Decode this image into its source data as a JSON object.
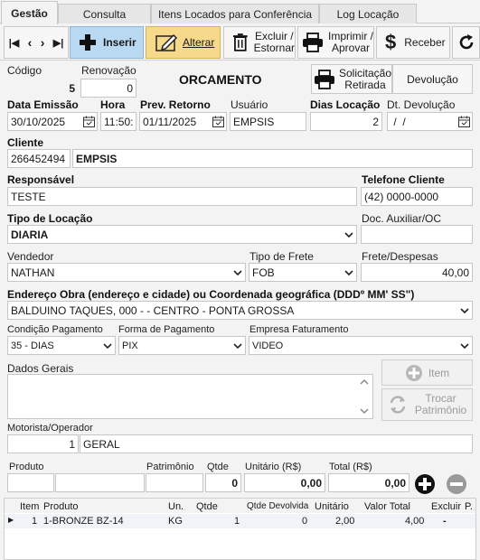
{
  "tabs": [
    "Gestão",
    "Consulta",
    "Itens Locados para Conferência",
    "Log Locação"
  ],
  "toolbar": {
    "inserir": "Inserir",
    "alterar": "Alterar",
    "excluir_1": "Excluir /",
    "excluir_2": "Estornar",
    "imprimir_1": "Imprimir /",
    "imprimir_2": "Aprovar",
    "receber": "Receber"
  },
  "header": {
    "codigo_label": "Código",
    "codigo": "5",
    "renovacao_label": "Renovação",
    "renovacao": "0",
    "title": "ORCAMENTO",
    "solicitacao_1": "Solicitação",
    "solicitacao_2": "Retirada",
    "devolucao": "Devolução"
  },
  "dates": {
    "emissao_label": "Data Emissão",
    "emissao": "30/10/2025",
    "hora_label": "Hora",
    "hora": "11:50:",
    "prev_label": "Prev. Retorno",
    "prev": "01/11/2025",
    "usuario_label": "Usuário",
    "usuario": "EMPSIS",
    "dias_label": "Dias Locação",
    "dias": "2",
    "dt_dev_label": "Dt. Devolução",
    "dt_dev": " /  /"
  },
  "cliente": {
    "label": "Cliente",
    "codigo": "266452494",
    "nome": "EMPSIS"
  },
  "responsavel": {
    "label": "Responsável",
    "value": "TESTE"
  },
  "telefone": {
    "label": "Telefone Cliente",
    "value": "(42) 0000-0000"
  },
  "tipo_locacao": {
    "label": "Tipo de Locação",
    "value": "DIARIA"
  },
  "doc_aux": {
    "label": "Doc. Auxiliar/OC",
    "value": ""
  },
  "vendedor": {
    "label": "Vendedor",
    "value": "NATHAN"
  },
  "tipo_frete": {
    "label": "Tipo de Frete",
    "value": "FOB"
  },
  "frete": {
    "label": "Frete/Despesas",
    "value": "40,00"
  },
  "endereco": {
    "label": "Endereço Obra (endereço e cidade) ou Coordenada geográfica (DDDº MM' SS\")",
    "value": "BALDUINO TAQUES, 000 -  - CENTRO - PONTA GROSSA"
  },
  "condicao": {
    "label": "Condição Pagamento",
    "value": "35 - DIAS"
  },
  "forma": {
    "label": "Forma de Pagamento",
    "value": "PIX"
  },
  "empresa": {
    "label": "Empresa Faturamento",
    "value": "VIDEO"
  },
  "dados_gerais": {
    "label": "Dados Gerais",
    "value": ""
  },
  "side_buttons": {
    "item": "Item",
    "trocar_1": "Trocar",
    "trocar_2": "Patrimônio"
  },
  "motorista": {
    "label": "Motorista/Operador",
    "codigo": "1",
    "nome": "GERAL"
  },
  "item_entry": {
    "produto_label": "Produto",
    "patrimonio_label": "Patrimônio",
    "qtde_label": "Qtde",
    "qtde": "0",
    "unitario_label": "Unitário (R$)",
    "unitario": "0,00",
    "total_label": "Total (R$)",
    "total": "0,00"
  },
  "grid": {
    "columns": [
      "Item",
      "Produto",
      "Un.",
      "Qtde",
      "Qtde Devolvida",
      "Unitário",
      "Valor Total",
      "Excluir",
      "P."
    ],
    "rows": [
      {
        "item": "1",
        "produto": "1-BRONZE BZ-14",
        "un": "KG",
        "qtde": "1",
        "qtde_dev": "0",
        "unitario": "2,00",
        "valor_total": "4,00",
        "excluir": "-"
      }
    ]
  }
}
